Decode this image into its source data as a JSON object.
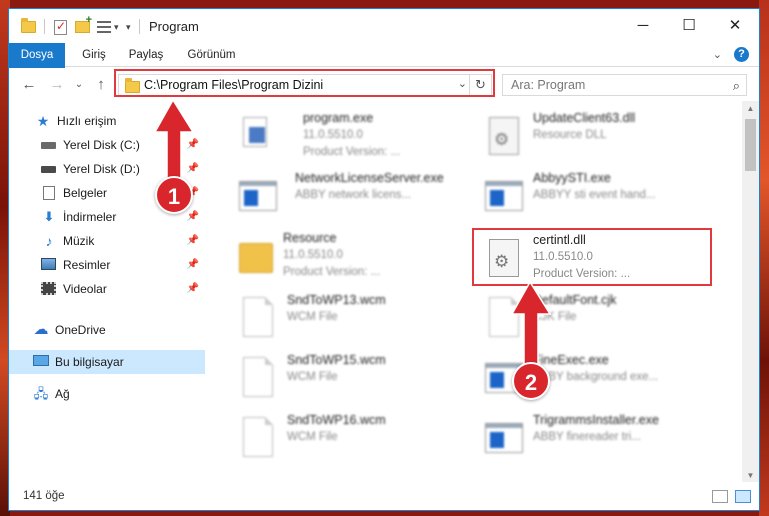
{
  "window": {
    "title": "Program",
    "accent": "#1979ca"
  },
  "ribbon": {
    "tabs": [
      "Dosya",
      "Giriş",
      "Paylaş",
      "Görünüm"
    ]
  },
  "address": {
    "path": "C:\\Program Files\\Program Dizini",
    "search_placeholder": "Ara: Program"
  },
  "sidebar": {
    "items": [
      {
        "label": "Hızlı erişim",
        "icon": "star-icon"
      },
      {
        "label": "Yerel Disk (C:)",
        "icon": "drive-icon"
      },
      {
        "label": "Yerel Disk (D:)",
        "icon": "drive-icon"
      },
      {
        "label": "Belgeler",
        "icon": "document-icon"
      },
      {
        "label": "İndirmeler",
        "icon": "download-icon"
      },
      {
        "label": "Müzik",
        "icon": "music-icon"
      },
      {
        "label": "Resimler",
        "icon": "pictures-icon"
      },
      {
        "label": "Videolar",
        "icon": "video-icon"
      },
      {
        "label": "OneDrive",
        "icon": "cloud-icon"
      },
      {
        "label": "Bu bilgisayar",
        "icon": "computer-icon"
      },
      {
        "label": "Ağ",
        "icon": "network-icon"
      }
    ]
  },
  "files": [
    {
      "name": "program.exe",
      "line2": "11.0.5510.0",
      "line3": "Product Version:   ..."
    },
    {
      "name": "UpdateClient63.dll",
      "line2": "Resource DLL",
      "line3": ""
    },
    {
      "name": "NetworkLicenseServer.exe",
      "line2": "ABBY network licens...",
      "line3": ""
    },
    {
      "name": "AbbyySTI.exe",
      "line2": "ABBYY sti event hand...",
      "line3": ""
    },
    {
      "name": "Resource",
      "line2": "11.0.5510.0",
      "line3": "Product Version:   ..."
    },
    {
      "name": "certintl.dll",
      "line2": "11.0.5510.0",
      "line3": "Product Version:   ..."
    },
    {
      "name": "SndToWP13.wcm",
      "line2": "WCM File",
      "line3": ""
    },
    {
      "name": "DefaultFont.cjk",
      "line2": "CJK File",
      "line3": ""
    },
    {
      "name": "SndToWP15.wcm",
      "line2": "WCM File",
      "line3": ""
    },
    {
      "name": "FineExec.exe",
      "line2": "ABBY background exe...",
      "line3": ""
    },
    {
      "name": "SndToWP16.wcm",
      "line2": "WCM File",
      "line3": ""
    },
    {
      "name": "TrigrammsInstaller.exe",
      "line2": "ABBY finereader tri...",
      "line3": ""
    }
  ],
  "annotations": {
    "badge1": "1",
    "badge2": "2",
    "highlight_color": "#e0393e"
  },
  "status": {
    "count": "141 öğe"
  }
}
